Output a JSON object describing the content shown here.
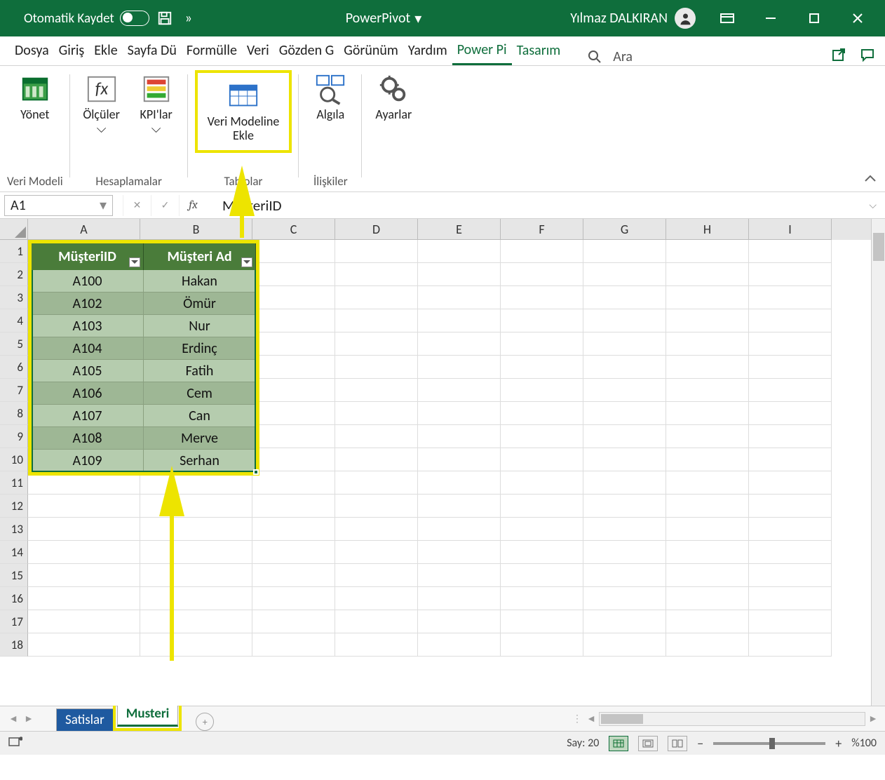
{
  "titlebar": {
    "autosave_label": "Otomatik Kaydet",
    "more": "»",
    "doc_title": "PowerPivot",
    "user_name": "Yılmaz DALKIRAN"
  },
  "tabs": {
    "file": "Dosya",
    "home": "Giriş",
    "insert": "Ekle",
    "pagelayout": "Sayfa Dü",
    "formulas": "Formülle",
    "data": "Veri",
    "review": "Gözden G",
    "view": "Görünüm",
    "help": "Yardım",
    "powerpivot": "Power Pi",
    "design": "Tasarım",
    "search": "Ara"
  },
  "ribbon": {
    "manage": "Yönet",
    "group_datamodel": "Veri Modeli",
    "measures": "Ölçüler",
    "kpis": "KPI'lar",
    "group_calc": "Hesaplamalar",
    "add_to_model_l1": "Veri Modeline",
    "add_to_model_l2": "Ekle",
    "group_tables": "Tablolar",
    "detect": "Algıla",
    "group_rel": "İlişkiler",
    "settings": "Ayarlar"
  },
  "formula_bar": {
    "name_box": "A1",
    "formula": "MüşteriID"
  },
  "columns": [
    "A",
    "B",
    "C",
    "D",
    "E",
    "F",
    "G",
    "H",
    "I"
  ],
  "rows": [
    1,
    2,
    3,
    4,
    5,
    6,
    7,
    8,
    9,
    10,
    11,
    12,
    13,
    14,
    15,
    16,
    17,
    18
  ],
  "table": {
    "headers": [
      "MüşteriID",
      "Müşteri Ad"
    ],
    "data": [
      [
        "A100",
        "Hakan"
      ],
      [
        "A102",
        "Ömür"
      ],
      [
        "A103",
        "Nur"
      ],
      [
        "A104",
        "Erdinç"
      ],
      [
        "A105",
        "Fatih"
      ],
      [
        "A106",
        "Cem"
      ],
      [
        "A107",
        "Can"
      ],
      [
        "A108",
        "Merve"
      ],
      [
        "A109",
        "Serhan"
      ]
    ]
  },
  "sheets": {
    "s1": "Satislar",
    "s2": "Musteri"
  },
  "status": {
    "count_label": "Say:",
    "count_value": "20",
    "zoom": "%100"
  }
}
